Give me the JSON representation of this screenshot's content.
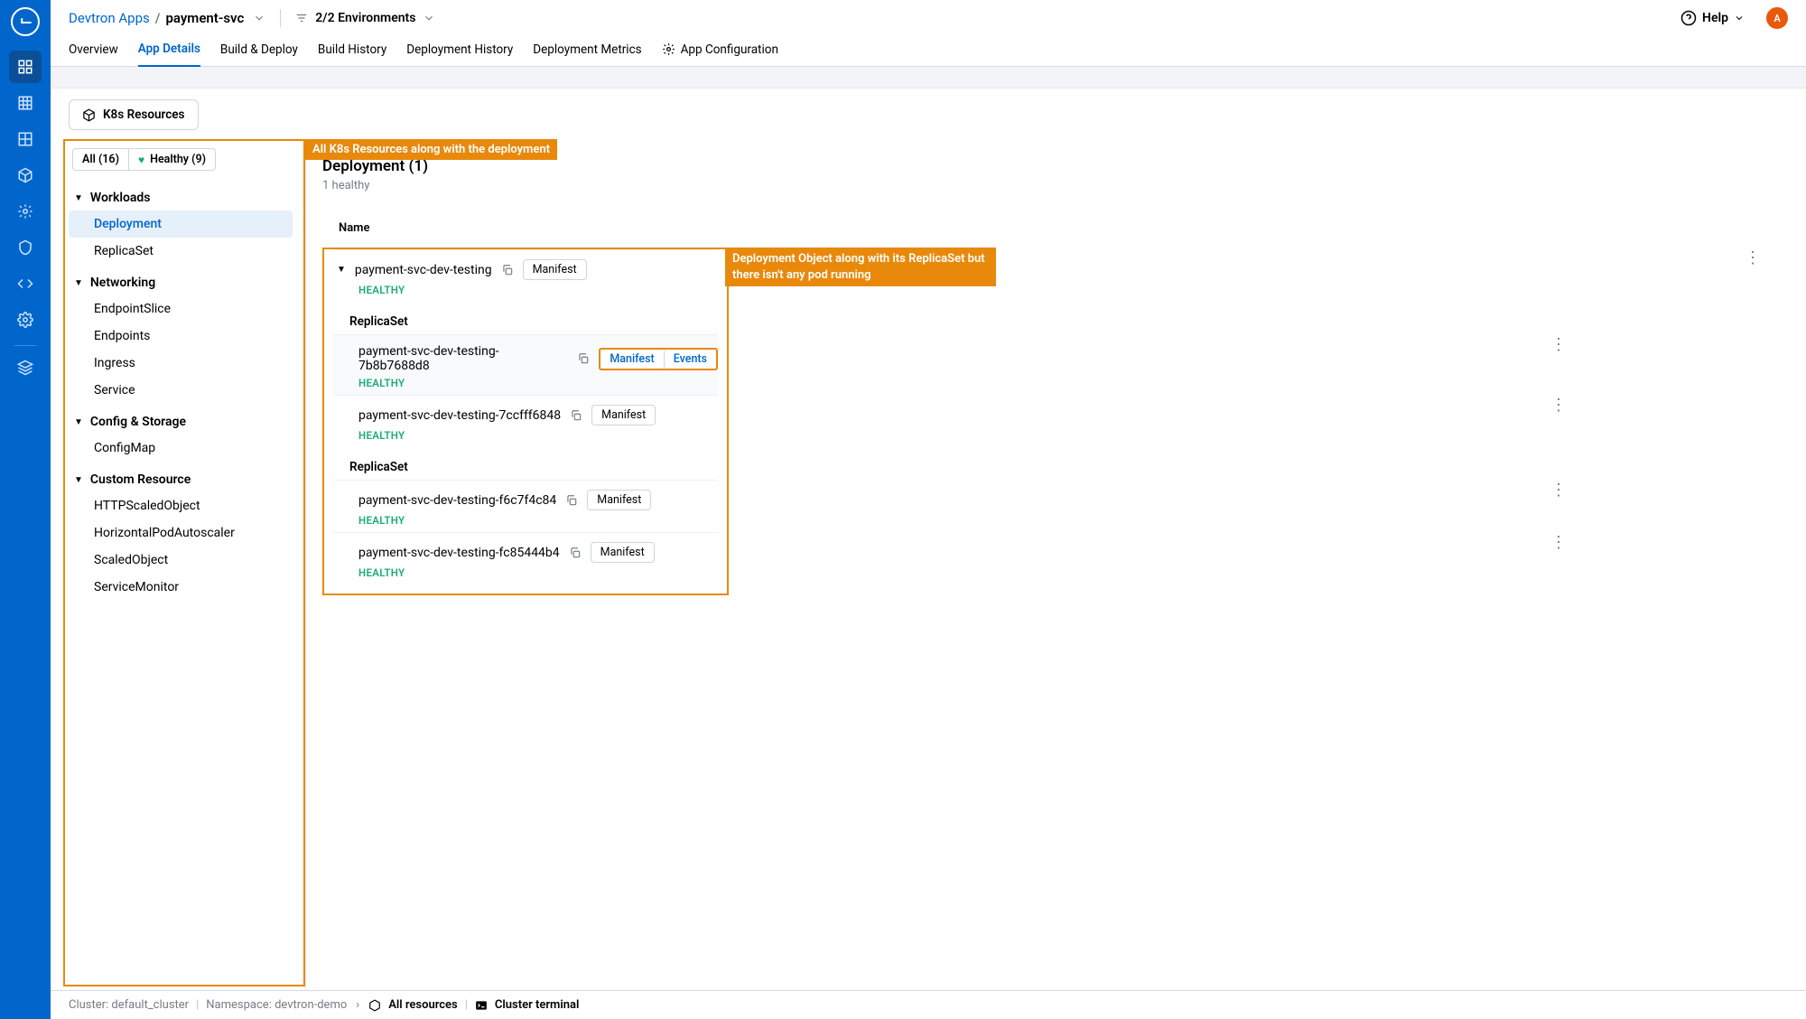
{
  "breadcrumb": {
    "root": "Devtron Apps",
    "current": "payment-svc"
  },
  "env_filter": "2/2 Environments",
  "help_label": "Help",
  "avatar_initial": "A",
  "tabs": {
    "overview": "Overview",
    "app_details": "App Details",
    "build_deploy": "Build & Deploy",
    "build_history": "Build History",
    "deployment_history": "Deployment History",
    "deployment_metrics": "Deployment Metrics",
    "app_config": "App Configuration"
  },
  "k8s_tab": "K8s Resources",
  "annotations": {
    "sidebar": "All K8s Resources along with the deployment",
    "deployment": "Deployment Object along with its ReplicaSet but there isn't any pod running"
  },
  "chips": {
    "all": "All (16)",
    "healthy": "Healthy (9)"
  },
  "tree": {
    "workloads": {
      "title": "Workloads",
      "items": [
        "Deployment",
        "ReplicaSet"
      ]
    },
    "networking": {
      "title": "Networking",
      "items": [
        "EndpointSlice",
        "Endpoints",
        "Ingress",
        "Service"
      ]
    },
    "config": {
      "title": "Config & Storage",
      "items": [
        "ConfigMap"
      ]
    },
    "custom": {
      "title": "Custom Resource",
      "items": [
        "HTTPScaledObject",
        "HorizontalPodAutoscaler",
        "ScaledObject",
        "ServiceMonitor"
      ]
    }
  },
  "detail": {
    "title": "Deployment (1)",
    "subtitle": "1 healthy",
    "col_name": "Name",
    "manifest_label": "Manifest",
    "events_label": "Events",
    "healthy_label": "HEALTHY",
    "replicaset_label": "ReplicaSet",
    "deployment_name": "payment-svc-dev-testing",
    "rs": [
      "payment-svc-dev-testing-7b8b7688d8",
      "payment-svc-dev-testing-7ccfff6848",
      "payment-svc-dev-testing-f6c7f4c84",
      "payment-svc-dev-testing-fc85444b4"
    ]
  },
  "footer": {
    "cluster": "Cluster: default_cluster",
    "namespace": "Namespace: devtron-demo",
    "all_resources": "All resources",
    "terminal": "Cluster terminal"
  }
}
